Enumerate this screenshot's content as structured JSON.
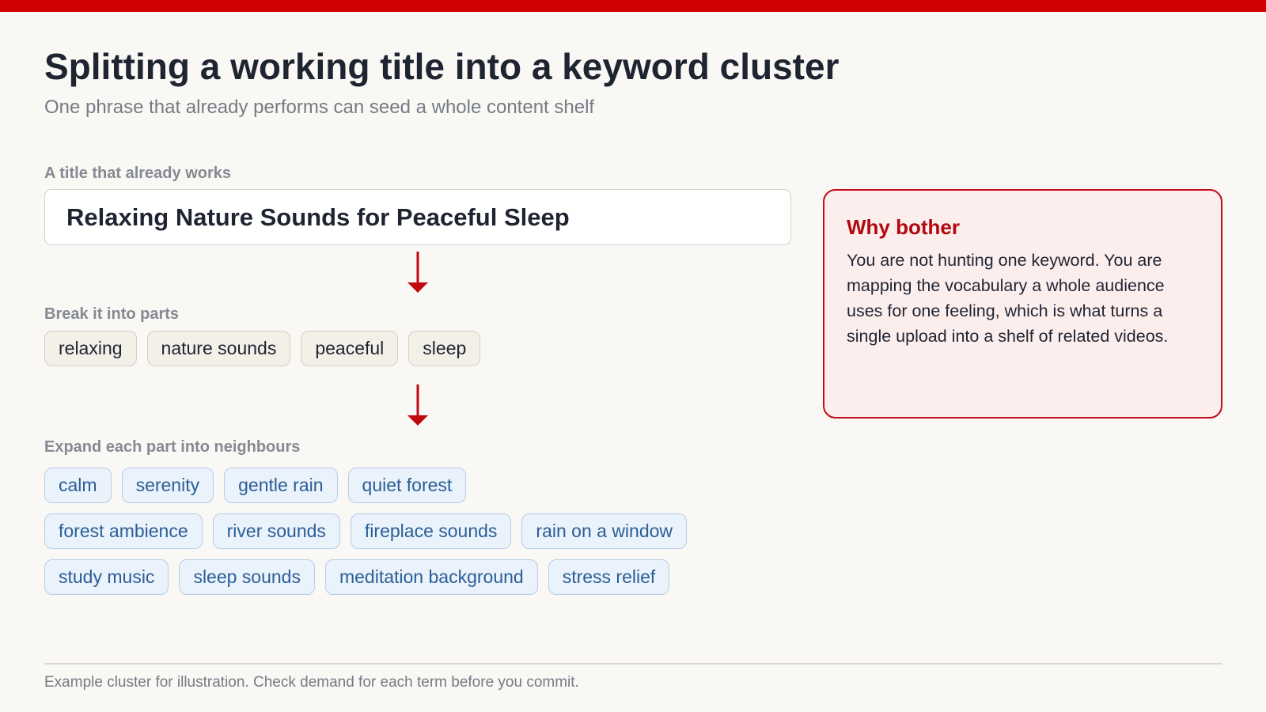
{
  "accent_color": "#d00000",
  "header": {
    "title": "Splitting a working title into a keyword cluster",
    "subtitle": "One phrase that already performs can seed a whole content shelf"
  },
  "title_section": {
    "label": "A title that already works",
    "title_text": "Relaxing Nature Sounds for Peaceful Sleep"
  },
  "parts_section": {
    "label": "Break it into parts",
    "parts": [
      "relaxing",
      "nature sounds",
      "peaceful",
      "sleep"
    ]
  },
  "neighbours_section": {
    "label": "Expand each part into neighbours",
    "rows": [
      [
        "calm",
        "serenity",
        "gentle rain",
        "quiet forest"
      ],
      [
        "forest ambience",
        "river sounds",
        "fireplace sounds",
        "rain on a window"
      ],
      [
        "study music",
        "sleep sounds",
        "meditation background",
        "stress relief"
      ]
    ]
  },
  "callout": {
    "title": "Why bother",
    "body": "You are not hunting one keyword. You are mapping the vocabulary a whole audience uses for one feeling, which is what turns a single upload into a shelf of related videos."
  },
  "footer": {
    "note": "Example cluster for illustration. Check demand for each term before you commit."
  },
  "icons": {
    "arrow": "arrow-down-icon"
  }
}
